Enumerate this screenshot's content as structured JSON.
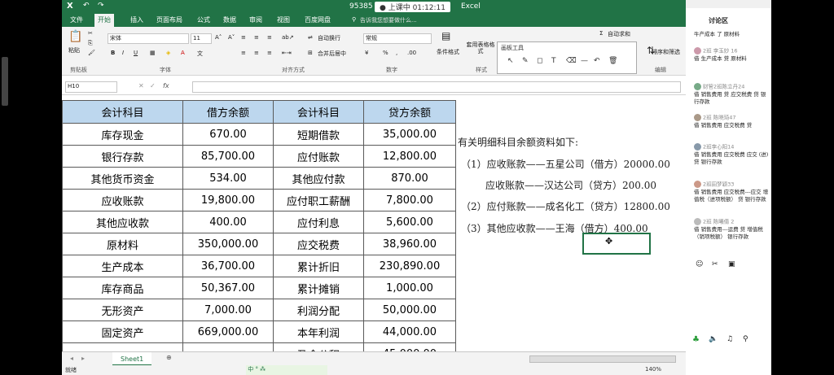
{
  "window": {
    "title_code": "95385",
    "live_status": "上课中 01:12:11",
    "app_name": "Excel"
  },
  "ribbon_tabs": [
    "文件",
    "开始",
    "插入",
    "页面布局",
    "公式",
    "数据",
    "审阅",
    "视图",
    "百度网盘"
  ],
  "search_hint": "告诉我您想要做什么...",
  "ribbon": {
    "clipboard": {
      "paste": "粘贴",
      "label": "剪贴板"
    },
    "font": {
      "name": "宋体",
      "size": "11",
      "label": "字体",
      "bold": "B",
      "italic": "I",
      "underline": "U"
    },
    "alignment": {
      "wrap": "自动换行",
      "merge": "合并后居中",
      "label": "对齐方式"
    },
    "number": {
      "format": "常规",
      "percent": "%",
      "label": "数字"
    },
    "styles": {
      "conditional": "条件格式",
      "table": "套用表格格式",
      "label": "样式"
    },
    "editing": {
      "autosum": "自动求和",
      "sort": "排序和筛选",
      "label": "编辑"
    },
    "drawing_tools": {
      "title": "画板工具"
    }
  },
  "formula_bar": {
    "name_box": "H10",
    "fx": "fx"
  },
  "table": {
    "headers": [
      "会计科目",
      "借方余额",
      "会计科目",
      "贷方余额"
    ],
    "rows": [
      [
        "库存现金",
        "670.00",
        "短期借款",
        "35,000.00"
      ],
      [
        "银行存款",
        "85,700.00",
        "应付账款",
        "12,800.00"
      ],
      [
        "其他货币资金",
        "534.00",
        "其他应付款",
        "870.00"
      ],
      [
        "应收账款",
        "19,800.00",
        "应付职工薪酬",
        "7,800.00"
      ],
      [
        "其他应收款",
        "400.00",
        "应付利息",
        "5,600.00"
      ],
      [
        "原材料",
        "350,000.00",
        "应交税费",
        "38,960.00"
      ],
      [
        "生产成本",
        "36,700.00",
        "累计折旧",
        "230,890.00"
      ],
      [
        "库存商品",
        "50,367.00",
        "累计摊销",
        "1,000.00"
      ],
      [
        "无形资产",
        "7,000.00",
        "利润分配",
        "50,000.00"
      ],
      [
        "固定资产",
        "669,000.00",
        "本年利润",
        "44,000.00"
      ],
      [
        "",
        "",
        "盈余公积",
        "45,000.00"
      ]
    ]
  },
  "notes": [
    "有关明细科目余额资料如下:",
    "（1）应收账款——五星公司（借方）20000.00",
    "应收账款——汉达公司（贷方）200.00",
    "（2）应付账款——成名化工（贷方）12800.00",
    "（3）其他应收款——王海（借方）400.00"
  ],
  "sheet_tab": "Sheet1",
  "status": {
    "ready": "就绪",
    "zoom": "140%"
  },
  "side_panel": {
    "title": "讨论区",
    "comments": [
      {
        "user": "",
        "text": "牛产成本 了 原材料"
      },
      {
        "user": "2班 李玉妙 16",
        "text": "借 生产成本 贷 原材料"
      },
      {
        "user": "财管2班陈立丹24",
        "text": "借 销售费用 贷 应交税费 贷 银行存款"
      },
      {
        "user": "2班 陈晓琦47",
        "text": "借 销售费用 应交税费 贷"
      },
      {
        "user": "2班李心阳14",
        "text": "借 销售费用 应交税费 应交 (进) 贷 银行存款"
      },
      {
        "user": "2班田梦颖33",
        "text": "借 销售费用 应交税费---应交 增值税（进项税额） 贷 银行存款"
      },
      {
        "user": "2班 陈曦倩 2",
        "text": "借 销售费用---运费 贷 增值税（销项税额） 银行存款"
      }
    ]
  },
  "colors": {
    "excel_green": "#217346",
    "header_fill": "#bdd7ee"
  }
}
